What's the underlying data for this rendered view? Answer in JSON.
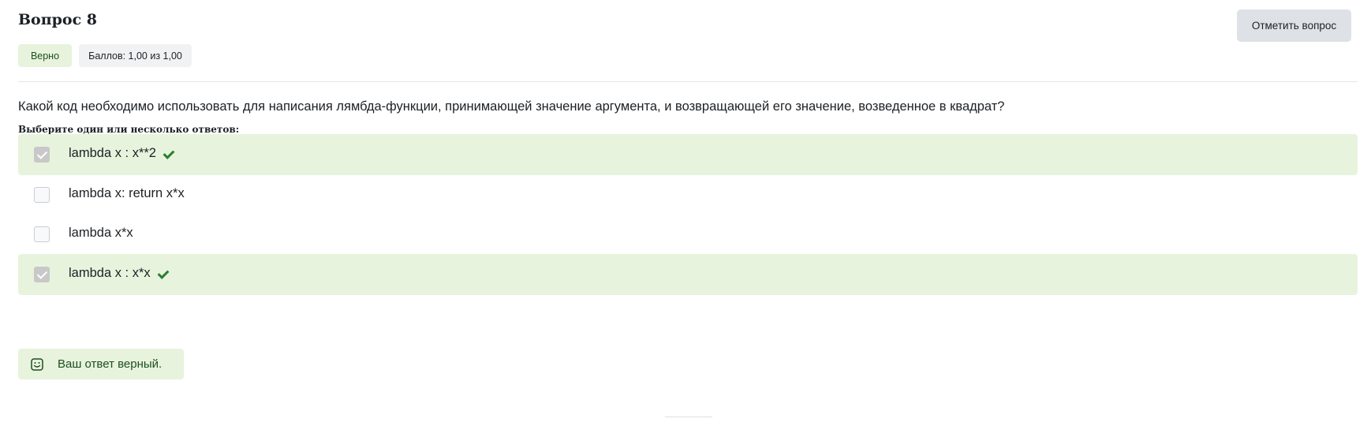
{
  "question": {
    "title": "Вопрос 8",
    "flag_button": "Отметить вопрос",
    "status": "Верно",
    "grade": "Баллов: 1,00 из 1,00",
    "text": "Какой код необходимо использовать для написания лямбда-функции, принимающей значение аргумента, и возвращающей его значение, возведенное в квадрат?",
    "prompt": "Выберите один или несколько ответов:"
  },
  "answers": [
    {
      "label": "lambda x : x**2",
      "checked": true,
      "correct": true
    },
    {
      "label": "lambda x: return x*x",
      "checked": false,
      "correct": false
    },
    {
      "label": "lambda x*x",
      "checked": false,
      "correct": false
    },
    {
      "label": "lambda x : x*x",
      "checked": true,
      "correct": true
    }
  ],
  "feedback": {
    "icon": "smile-icon",
    "text": "Ваш ответ верный."
  },
  "colors": {
    "correct_bg": "#e8f3dd",
    "tick": "#2a7f2e",
    "feedback_text": "#1c4f1f"
  }
}
